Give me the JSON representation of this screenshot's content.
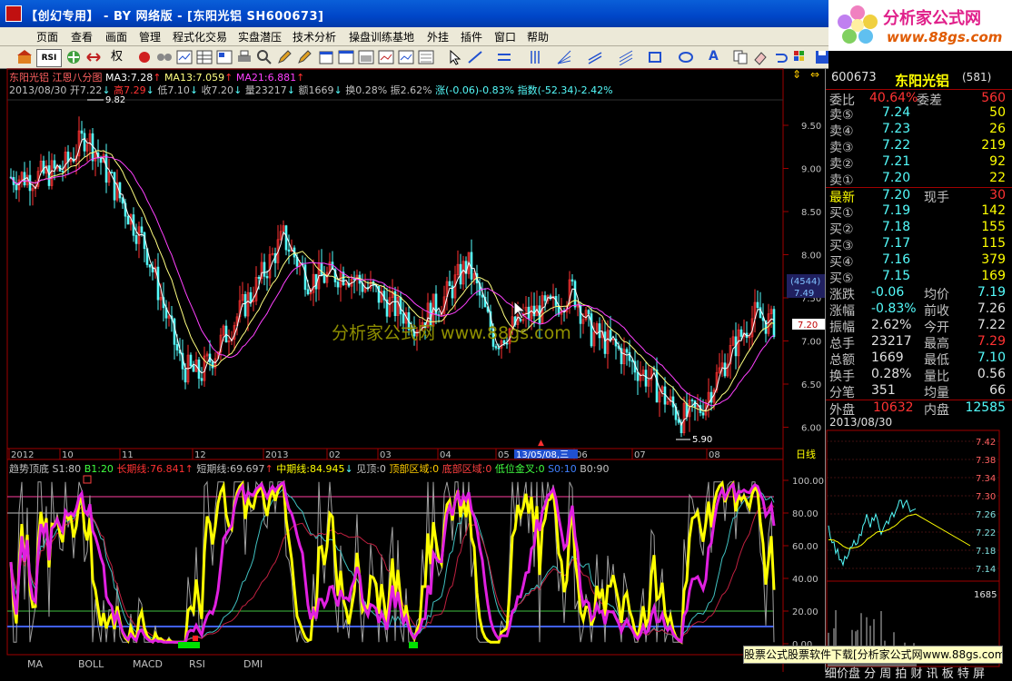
{
  "window": {
    "title": "【创幻专用】 - BY 网络版 - [东阳光铝 SH600673]"
  },
  "banner": {
    "line1": "分析家公式网",
    "line2": "www.88gs.com"
  },
  "menu": [
    "页面",
    "查看",
    "画面",
    "管理",
    "程式化交易",
    "实盘潜压",
    "技术分析",
    "操盘训练基地",
    "外挂",
    "插件",
    "窗口",
    "帮助"
  ],
  "toolbar": {
    "quan_label": "权",
    "rsi_label": "RSI"
  },
  "kline": {
    "header": {
      "name": "东阳光铝",
      "type": "江恩八分图",
      "ma3": "MA3:7.28",
      "ma13": "MA13:7.059",
      "ma21": "MA21:6.881"
    },
    "info": {
      "date": "2013/08/30",
      "open": "开7.22",
      "high": "高7.29",
      "low": "低7.10",
      "close": "收7.20",
      "vol": "量23217",
      "amount": "额1669",
      "turnover": "换0.28%",
      "amplitude": "振2.62%",
      "change": "涨(-0.06)-0.83%",
      "index": "指数(-52.34)-2.42%"
    },
    "price_axis": [
      "9.50",
      "9.00",
      "8.50",
      "8.00",
      "7.50",
      "7.00",
      "6.50",
      "6.00"
    ],
    "high_mark": "9.82",
    "low_mark": "5.90",
    "last_tag": "7.20",
    "cursor_box": {
      "count": "(4544)",
      "price": "7.49"
    },
    "watermark": "分析家公式网 www.88gs.com",
    "date_axis": [
      "2012",
      "10",
      "11",
      "12",
      "2013",
      "02",
      "03",
      "04",
      "05",
      "06",
      "07",
      "08"
    ],
    "date_cursor": "13/05/08,三",
    "period_label": "日线"
  },
  "indicator": {
    "name": "趋势顶底",
    "s1": "S1:80",
    "b1": "B1:20",
    "long": "长期线:76.841",
    "short": "短期线:69.697",
    "mid": "中期线:84.945",
    "top": "见顶:0",
    "topzone": "顶部区域:0",
    "bottomzone": "底部区域:0",
    "lowcross": "低位金叉:0",
    "s0": "S0:10",
    "b0": "B0:90",
    "axis": [
      "100.00",
      "80.00",
      "60.00",
      "40.00",
      "20.00",
      "0.00"
    ]
  },
  "tabs": [
    "MA",
    "BOLL",
    "MACD",
    "RSI",
    "DMI"
  ],
  "quote": {
    "code": "600673",
    "name": "东阳光铝",
    "board": "(581)",
    "ratio": {
      "label": "委比",
      "value": "40.64%",
      "label2": "委差",
      "value2": "560"
    },
    "sell": [
      {
        "label": "卖⑤",
        "price": "7.24",
        "vol": "50"
      },
      {
        "label": "卖④",
        "price": "7.23",
        "vol": "26"
      },
      {
        "label": "卖③",
        "price": "7.22",
        "vol": "219"
      },
      {
        "label": "卖②",
        "price": "7.21",
        "vol": "92"
      },
      {
        "label": "卖①",
        "price": "7.20",
        "vol": "22"
      }
    ],
    "latest": {
      "label": "最新",
      "price": "7.20",
      "label2": "现手",
      "vol": "30"
    },
    "buy": [
      {
        "label": "买①",
        "price": "7.19",
        "vol": "142"
      },
      {
        "label": "买②",
        "price": "7.18",
        "vol": "155"
      },
      {
        "label": "买③",
        "price": "7.17",
        "vol": "115"
      },
      {
        "label": "买④",
        "price": "7.16",
        "vol": "379"
      },
      {
        "label": "买⑤",
        "price": "7.15",
        "vol": "169"
      }
    ],
    "stats": [
      {
        "l1": "涨跌",
        "v1": "-0.06",
        "l2": "均价",
        "v2": "7.19"
      },
      {
        "l1": "涨幅",
        "v1": "-0.83%",
        "l2": "前收",
        "v2": "7.26"
      },
      {
        "l1": "振幅",
        "v1": "2.62%",
        "l2": "今开",
        "v2": "7.22"
      },
      {
        "l1": "总手",
        "v1": "23217",
        "l2": "最高",
        "v2": "7.29"
      },
      {
        "l1": "总额",
        "v1": "1669",
        "l2": "最低",
        "v2": "7.10"
      },
      {
        "l1": "换手",
        "v1": "0.28%",
        "l2": "量比",
        "v2": "0.56"
      },
      {
        "l1": "分笔",
        "v1": "351",
        "l2": "均量",
        "v2": "66"
      }
    ],
    "outer": {
      "l1": "外盘",
      "v1": "10632",
      "l2": "内盘",
      "v2": "12585"
    },
    "intraday_date": "2013/08/30",
    "intraday_axis": [
      "7.42",
      "7.38",
      "7.34",
      "7.30",
      "7.26",
      "7.22",
      "7.18",
      "7.14"
    ],
    "vol_axis": "1685"
  },
  "download_bar": "股票公式股票软件下载[分析家公式网www.88gs.com]",
  "bottom_strip": "细价盘 分 周 拍 财 讯 板 特 屏",
  "colors": {
    "up": "#ff3232",
    "down": "#54fcfc",
    "yellow": "#ffff00",
    "magenta": "#ff00ff",
    "bg": "#000000"
  }
}
